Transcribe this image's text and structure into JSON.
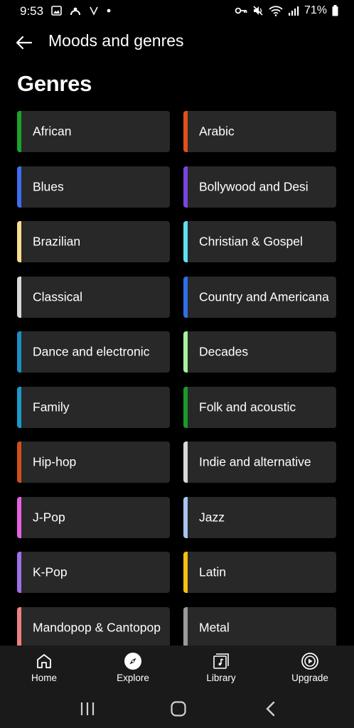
{
  "status_bar": {
    "time": "9:53",
    "battery": "71%"
  },
  "header": {
    "title": "Moods and genres"
  },
  "section": {
    "title": "Genres"
  },
  "genres": [
    {
      "label": "African",
      "color": "#1aa32b"
    },
    {
      "label": "Arabic",
      "color": "#e0501a"
    },
    {
      "label": "Blues",
      "color": "#3d6ef0"
    },
    {
      "label": "Bollywood and Desi",
      "color": "#7a45e0"
    },
    {
      "label": "Brazilian",
      "color": "#f5e08a"
    },
    {
      "label": "Christian & Gospel",
      "color": "#5ee0f0"
    },
    {
      "label": "Classical",
      "color": "#d8d8d8"
    },
    {
      "label": "Country and Americana",
      "color": "#2f6fe8"
    },
    {
      "label": "Dance and electronic",
      "color": "#1a8fc0"
    },
    {
      "label": "Decades",
      "color": "#a8f0a0"
    },
    {
      "label": "Family",
      "color": "#1a9ac8"
    },
    {
      "label": "Folk and acoustic",
      "color": "#1a9a2b"
    },
    {
      "label": "Hip-hop",
      "color": "#d0501a"
    },
    {
      "label": "Indie and alternative",
      "color": "#d8d8d8"
    },
    {
      "label": "J-Pop",
      "color": "#e860e0"
    },
    {
      "label": "Jazz",
      "color": "#a8c4f0"
    },
    {
      "label": "K-Pop",
      "color": "#a070e8"
    },
    {
      "label": "Latin",
      "color": "#f5c010"
    },
    {
      "label": "Mandopop & Cantopop",
      "color": "#f08080"
    },
    {
      "label": "Metal",
      "color": "#9a9a9a"
    }
  ],
  "bottom_nav": [
    {
      "label": "Home",
      "icon": "home-icon"
    },
    {
      "label": "Explore",
      "icon": "compass-icon"
    },
    {
      "label": "Library",
      "icon": "library-icon"
    },
    {
      "label": "Upgrade",
      "icon": "upgrade-icon"
    }
  ]
}
